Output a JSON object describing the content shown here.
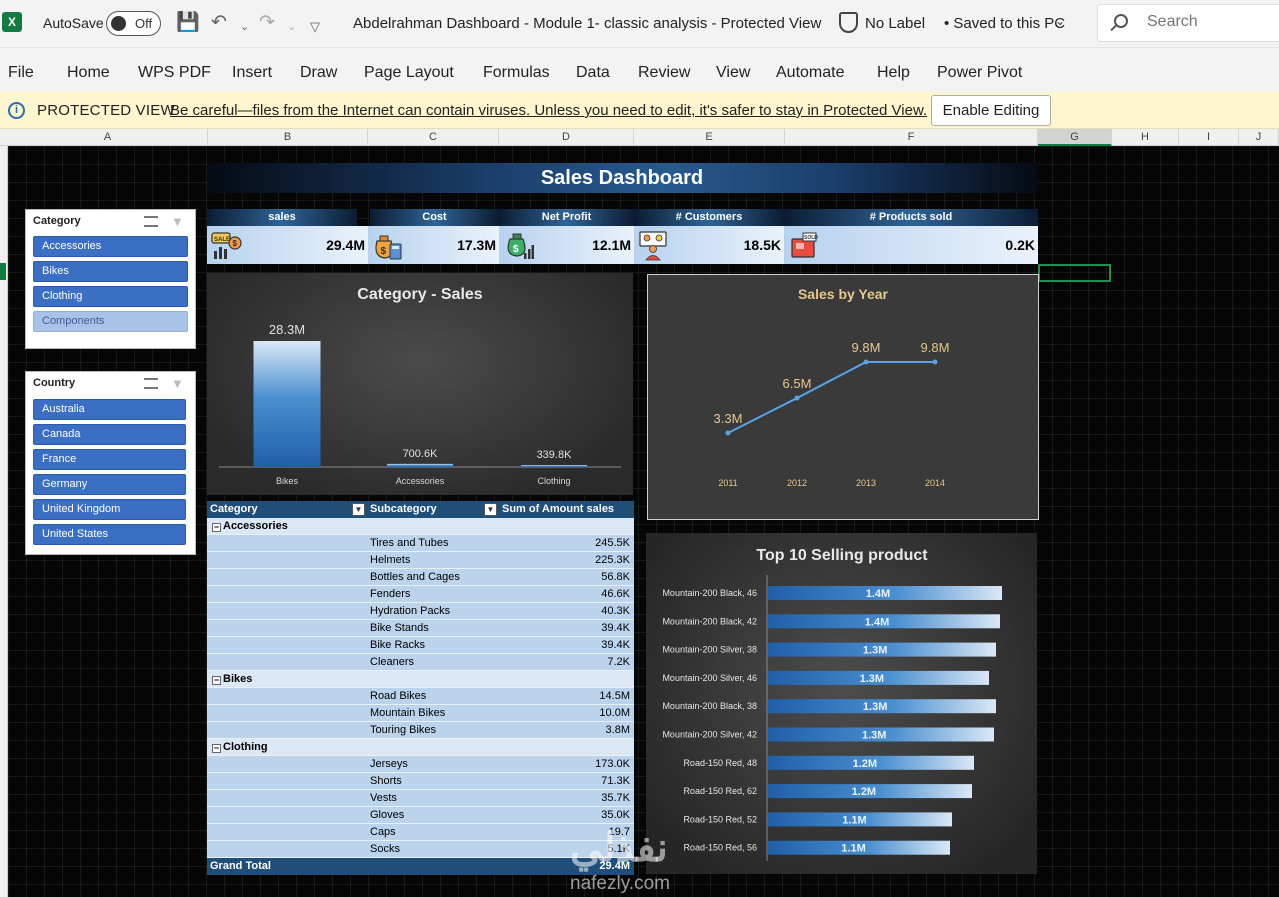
{
  "titlebar": {
    "autosave_label": "AutoSave",
    "autosave_state": "Off",
    "document_title": "Abdelrahman Dashboard - Module 1- classic analysis  -  Protected View",
    "sensitivity_label": "No Label",
    "saved_status": "•  Saved to this PC",
    "search_placeholder": "Search"
  },
  "ribbon": {
    "tabs": [
      "File",
      "Home",
      "WPS PDF",
      "Insert",
      "Draw",
      "Page Layout",
      "Formulas",
      "Data",
      "Review",
      "View",
      "Automate",
      "Help",
      "Power Pivot"
    ]
  },
  "protected_view": {
    "title": "PROTECTED VIEW",
    "message": "Be careful—files from the Internet can contain viruses. Unless you need to edit, it's safer to stay in Protected View.",
    "button": "Enable Editing"
  },
  "columns": [
    "A",
    "B",
    "C",
    "D",
    "E",
    "F",
    "G",
    "H",
    "I",
    "J"
  ],
  "dashboard": {
    "title": "Sales Dashboard",
    "kpis": [
      {
        "label": "sales",
        "value": "29.4M",
        "icon": "sales-chart-icon"
      },
      {
        "label": "Cost",
        "value": "17.3M",
        "icon": "money-bag-calculator-icon"
      },
      {
        "label": "Net Profit",
        "value": "12.1M",
        "icon": "profit-bag-icon"
      },
      {
        "label": "# Customers",
        "value": "18.5K",
        "icon": "customers-icon"
      },
      {
        "label": "# Products sold",
        "value": "0.2K",
        "icon": "sold-products-icon"
      }
    ]
  },
  "slicers": {
    "category": {
      "title": "Category",
      "items": [
        {
          "label": "Accessories",
          "selected": true
        },
        {
          "label": "Bikes",
          "selected": true
        },
        {
          "label": "Clothing",
          "selected": true
        },
        {
          "label": "Components",
          "selected": false
        }
      ]
    },
    "country": {
      "title": "Country",
      "items": [
        {
          "label": "Australia",
          "selected": true
        },
        {
          "label": "Canada",
          "selected": true
        },
        {
          "label": "France",
          "selected": true
        },
        {
          "label": "Germany",
          "selected": true
        },
        {
          "label": "United Kingdom",
          "selected": true
        },
        {
          "label": "United States",
          "selected": true
        }
      ]
    }
  },
  "charts": {
    "category_sales": {
      "title": "Category - Sales",
      "categories": [
        "Bikes",
        "Accessories",
        "Clothing"
      ],
      "values": [
        28.3,
        0.7006,
        0.3398
      ],
      "labels": [
        "28.3M",
        "700.6K",
        "339.8K"
      ]
    },
    "sales_by_year": {
      "title": "Sales by Year",
      "years": [
        "2011",
        "2012",
        "2013",
        "2014"
      ],
      "values": [
        3.3,
        6.5,
        9.8,
        9.8
      ],
      "labels": [
        "3.3M",
        "6.5M",
        "9.8M",
        "9.8M"
      ]
    },
    "top10": {
      "title": "Top 10 Selling product",
      "products": [
        "Mountain-200 Black, 46",
        "Mountain-200 Black, 42",
        "Mountain-200 Silver, 38",
        "Mountain-200 Silver, 46",
        "Mountain-200 Black, 38",
        "Mountain-200 Silver, 42",
        "Road-150 Red, 48",
        "Road-150 Red, 62",
        "Road-150 Red, 52",
        "Road-150 Red, 56"
      ],
      "values": [
        1.4,
        1.4,
        1.3,
        1.3,
        1.3,
        1.3,
        1.2,
        1.2,
        1.1,
        1.1
      ],
      "labels": [
        "1.4M",
        "1.4M",
        "1.3M",
        "1.3M",
        "1.3M",
        "1.3M",
        "1.2M",
        "1.2M",
        "1.1M",
        "1.1M"
      ]
    }
  },
  "chart_data": [
    {
      "type": "bar",
      "title": "Category - Sales",
      "categories": [
        "Bikes",
        "Accessories",
        "Clothing"
      ],
      "values": [
        28.3,
        0.7006,
        0.3398
      ],
      "data_labels": [
        "28.3M",
        "700.6K",
        "339.8K"
      ],
      "xlabel": "",
      "ylabel": "",
      "grid": false
    },
    {
      "type": "line",
      "title": "Sales by Year",
      "x": [
        "2011",
        "2012",
        "2013",
        "2014"
      ],
      "values": [
        3.3,
        6.5,
        9.8,
        9.8
      ],
      "data_labels": [
        "3.3M",
        "6.5M",
        "9.8M",
        "9.8M"
      ],
      "xlabel": "",
      "ylabel": "",
      "grid": false
    },
    {
      "type": "bar",
      "orientation": "horizontal",
      "title": "Top 10 Selling product",
      "categories": [
        "Mountain-200 Black, 46",
        "Mountain-200 Black, 42",
        "Mountain-200 Silver, 38",
        "Mountain-200 Silver, 46",
        "Mountain-200 Black, 38",
        "Mountain-200 Silver, 42",
        "Road-150 Red, 48",
        "Road-150 Red, 62",
        "Road-150 Red, 52",
        "Road-150 Red, 56"
      ],
      "values": [
        1.4,
        1.4,
        1.3,
        1.3,
        1.3,
        1.3,
        1.2,
        1.2,
        1.1,
        1.1
      ],
      "data_labels": [
        "1.4M",
        "1.4M",
        "1.3M",
        "1.3M",
        "1.3M",
        "1.3M",
        "1.2M",
        "1.2M",
        "1.1M",
        "1.1M"
      ],
      "grid": false
    }
  ],
  "pivot": {
    "headers": [
      "Category",
      "Subcategory",
      "Sum of Amount sales"
    ],
    "groups": [
      {
        "name": "Accessories",
        "rows": [
          {
            "sub": "Tires and Tubes",
            "value": "245.5K"
          },
          {
            "sub": "Helmets",
            "value": "225.3K"
          },
          {
            "sub": "Bottles and Cages",
            "value": "56.8K"
          },
          {
            "sub": "Fenders",
            "value": "46.6K"
          },
          {
            "sub": "Hydration Packs",
            "value": "40.3K"
          },
          {
            "sub": "Bike Stands",
            "value": "39.4K"
          },
          {
            "sub": "Bike Racks",
            "value": "39.4K"
          },
          {
            "sub": "Cleaners",
            "value": "7.2K"
          }
        ]
      },
      {
        "name": "Bikes",
        "rows": [
          {
            "sub": "Road Bikes",
            "value": "14.5M"
          },
          {
            "sub": "Mountain Bikes",
            "value": "10.0M"
          },
          {
            "sub": "Touring Bikes",
            "value": "3.8M"
          }
        ]
      },
      {
        "name": "Clothing",
        "rows": [
          {
            "sub": "Jerseys",
            "value": "173.0K"
          },
          {
            "sub": "Shorts",
            "value": "71.3K"
          },
          {
            "sub": "Vests",
            "value": "35.7K"
          },
          {
            "sub": "Gloves",
            "value": "35.0K"
          },
          {
            "sub": "Caps",
            "value": "19.7"
          },
          {
            "sub": "Socks",
            "value": "5.1K"
          }
        ]
      }
    ],
    "grand_total_label": "Grand Total",
    "grand_total_value": "29.4M"
  },
  "watermark": {
    "text": "nafezly.com"
  }
}
